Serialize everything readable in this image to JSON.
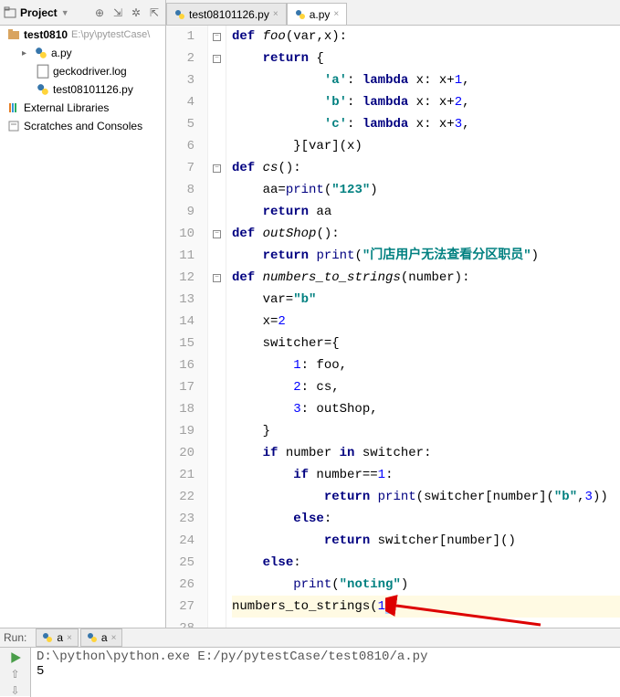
{
  "header": {
    "project_label": "Project"
  },
  "tabs": [
    {
      "name": "test08101126.py",
      "active": false
    },
    {
      "name": "a.py",
      "active": true
    }
  ],
  "tree": {
    "root": {
      "name": "test0810",
      "path": "E:\\py\\pytestCase\\"
    },
    "children": [
      {
        "name": "a.py",
        "type": "py"
      },
      {
        "name": "geckodriver.log",
        "type": "log"
      },
      {
        "name": "test08101126.py",
        "type": "py"
      }
    ],
    "external": "External Libraries",
    "scratches": "Scratches and Consoles"
  },
  "code": {
    "lines": [
      {
        "n": 1,
        "fold": "-",
        "seg": [
          {
            "c": "kw",
            "t": "def"
          },
          {
            "t": " "
          },
          {
            "c": "fn",
            "t": "foo"
          },
          {
            "t": "(var,x):"
          }
        ]
      },
      {
        "n": 2,
        "fold": "-",
        "seg": [
          {
            "t": "    "
          },
          {
            "c": "kw",
            "t": "return"
          },
          {
            "t": " {"
          }
        ]
      },
      {
        "n": 3,
        "seg": [
          {
            "t": "            "
          },
          {
            "c": "str",
            "t": "'a'"
          },
          {
            "t": ": "
          },
          {
            "c": "kw",
            "t": "lambda"
          },
          {
            "t": " x: x+"
          },
          {
            "c": "num",
            "t": "1"
          },
          {
            "t": ","
          }
        ]
      },
      {
        "n": 4,
        "seg": [
          {
            "t": "            "
          },
          {
            "c": "str",
            "t": "'b'"
          },
          {
            "t": ": "
          },
          {
            "c": "kw",
            "t": "lambda"
          },
          {
            "t": " x: x+"
          },
          {
            "c": "num",
            "t": "2"
          },
          {
            "t": ","
          }
        ]
      },
      {
        "n": 5,
        "seg": [
          {
            "t": "            "
          },
          {
            "c": "str",
            "t": "'c'"
          },
          {
            "t": ": "
          },
          {
            "c": "kw",
            "t": "lambda"
          },
          {
            "t": " x: x+"
          },
          {
            "c": "num",
            "t": "3"
          },
          {
            "t": ","
          }
        ]
      },
      {
        "n": 6,
        "seg": [
          {
            "t": "        }[var](x)"
          }
        ]
      },
      {
        "n": 7,
        "fold": "-",
        "seg": [
          {
            "c": "kw",
            "t": "def"
          },
          {
            "t": " "
          },
          {
            "c": "fn",
            "t": "cs"
          },
          {
            "t": "():"
          }
        ]
      },
      {
        "n": 8,
        "seg": [
          {
            "t": "    aa="
          },
          {
            "c": "builtin",
            "t": "print"
          },
          {
            "t": "("
          },
          {
            "c": "str",
            "t": "\"123\""
          },
          {
            "t": ")"
          }
        ]
      },
      {
        "n": 9,
        "seg": [
          {
            "t": "    "
          },
          {
            "c": "kw",
            "t": "return"
          },
          {
            "t": " aa"
          }
        ]
      },
      {
        "n": 10,
        "fold": "-",
        "seg": [
          {
            "c": "kw",
            "t": "def"
          },
          {
            "t": " "
          },
          {
            "c": "fn",
            "t": "outShop"
          },
          {
            "t": "():"
          }
        ]
      },
      {
        "n": 11,
        "seg": [
          {
            "t": "    "
          },
          {
            "c": "kw",
            "t": "return"
          },
          {
            "t": " "
          },
          {
            "c": "builtin",
            "t": "print"
          },
          {
            "t": "("
          },
          {
            "c": "str",
            "t": "\"门店用户无法查看分区职员\""
          },
          {
            "t": ")"
          }
        ]
      },
      {
        "n": 12,
        "fold": "-",
        "seg": [
          {
            "c": "kw",
            "t": "def"
          },
          {
            "t": " "
          },
          {
            "c": "fn",
            "t": "numbers_to_strings"
          },
          {
            "t": "(number):"
          }
        ]
      },
      {
        "n": 13,
        "seg": [
          {
            "t": "    var="
          },
          {
            "c": "str",
            "t": "\"b\""
          }
        ]
      },
      {
        "n": 14,
        "seg": [
          {
            "t": "    x="
          },
          {
            "c": "num",
            "t": "2"
          }
        ]
      },
      {
        "n": 15,
        "seg": [
          {
            "t": "    switcher={"
          }
        ]
      },
      {
        "n": 16,
        "seg": [
          {
            "t": "        "
          },
          {
            "c": "num",
            "t": "1"
          },
          {
            "t": ": foo,"
          }
        ]
      },
      {
        "n": 17,
        "seg": [
          {
            "t": "        "
          },
          {
            "c": "num",
            "t": "2"
          },
          {
            "t": ": cs,"
          }
        ]
      },
      {
        "n": 18,
        "seg": [
          {
            "t": "        "
          },
          {
            "c": "num",
            "t": "3"
          },
          {
            "t": ": outShop,"
          }
        ]
      },
      {
        "n": 19,
        "seg": [
          {
            "t": "    }"
          }
        ]
      },
      {
        "n": 20,
        "seg": [
          {
            "t": "    "
          },
          {
            "c": "kw",
            "t": "if"
          },
          {
            "t": " number "
          },
          {
            "c": "kw",
            "t": "in"
          },
          {
            "t": " switcher:"
          }
        ]
      },
      {
        "n": 21,
        "seg": [
          {
            "t": "        "
          },
          {
            "c": "kw",
            "t": "if"
          },
          {
            "t": " number=="
          },
          {
            "c": "num",
            "t": "1"
          },
          {
            "t": ":"
          }
        ]
      },
      {
        "n": 22,
        "seg": [
          {
            "t": "            "
          },
          {
            "c": "kw",
            "t": "return"
          },
          {
            "t": " "
          },
          {
            "c": "builtin",
            "t": "print"
          },
          {
            "t": "(switcher[number]("
          },
          {
            "c": "str",
            "t": "\"b\""
          },
          {
            "t": ","
          },
          {
            "c": "num",
            "t": "3"
          },
          {
            "t": "))"
          }
        ]
      },
      {
        "n": 23,
        "seg": [
          {
            "t": "        "
          },
          {
            "c": "kw",
            "t": "else"
          },
          {
            "t": ":"
          }
        ]
      },
      {
        "n": 24,
        "seg": [
          {
            "t": "            "
          },
          {
            "c": "kw",
            "t": "return"
          },
          {
            "t": " switcher[number]()"
          }
        ]
      },
      {
        "n": 25,
        "seg": [
          {
            "t": "    "
          },
          {
            "c": "kw",
            "t": "else"
          },
          {
            "t": ":"
          }
        ]
      },
      {
        "n": 26,
        "seg": [
          {
            "t": "        "
          },
          {
            "c": "builtin",
            "t": "print"
          },
          {
            "t": "("
          },
          {
            "c": "str",
            "t": "\"noting\""
          },
          {
            "t": ")"
          }
        ]
      },
      {
        "n": 27,
        "hl": true,
        "caret": true,
        "seg": [
          {
            "t": "numbers_to_strings("
          },
          {
            "c": "num",
            "t": "1"
          },
          {
            "c": "sel",
            "t": ")"
          }
        ]
      },
      {
        "n": 28,
        "seg": [
          {
            "t": ""
          }
        ]
      }
    ]
  },
  "run": {
    "label": "Run:",
    "tabs": [
      {
        "name": "a"
      },
      {
        "name": "a"
      }
    ],
    "output": {
      "path": "D:\\python\\python.exe E:/py/pytestCase/test0810/a.py",
      "result": "5"
    }
  }
}
